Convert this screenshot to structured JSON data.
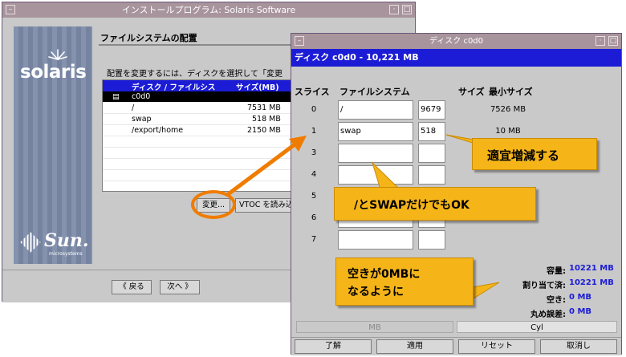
{
  "back_window": {
    "title": "インストールプログラム: Solaris Software",
    "brand": "solaris",
    "sun_brand": "Sun.",
    "sun_sub": "microsystems",
    "page_title": "ファイルシステムの配置",
    "instruction": "配置を変更するには、ディスクを選択して「変更",
    "list": {
      "headers": [
        "ディスク / ファイルシス",
        "サイズ(MB)"
      ],
      "rows": [
        {
          "name": "c0d0",
          "size": "",
          "selected": true
        },
        {
          "name": "/",
          "size": "7531 MB",
          "selected": false
        },
        {
          "name": "swap",
          "size": "518 MB",
          "selected": false
        },
        {
          "name": "/export/home",
          "size": "2150 MB",
          "selected": false
        }
      ]
    },
    "change_button": "変更...",
    "vtoc_button": "VTOC を読み込",
    "back_button": "《 戻る",
    "next_button": "次へ 》"
  },
  "front_window": {
    "title": "ディスク c0d0",
    "header": "ディスク c0d0 - 10,221 MB",
    "columns": {
      "slice": "スライス",
      "fs": "ファイルシステム",
      "size": "サイズ",
      "min": "最小サイズ"
    },
    "slices": [
      {
        "num": "0",
        "fs": "/",
        "size": "9679",
        "min": "7526 MB"
      },
      {
        "num": "1",
        "fs": "swap",
        "size": "518",
        "min": "10 MB"
      },
      {
        "num": "3",
        "fs": "",
        "size": "",
        "min": ""
      },
      {
        "num": "4",
        "fs": "",
        "size": "",
        "min": ""
      },
      {
        "num": "5",
        "fs": "",
        "size": "",
        "min": ""
      },
      {
        "num": "6",
        "fs": "",
        "size": "",
        "min": ""
      },
      {
        "num": "7",
        "fs": "",
        "size": "",
        "min": ""
      }
    ],
    "summary": [
      {
        "label": "容量:",
        "value": "10221 MB"
      },
      {
        "label": "割り当て済:",
        "value": "10221 MB"
      },
      {
        "label": "空き:",
        "value": "0 MB"
      },
      {
        "label": "丸め誤差:",
        "value": "0 MB"
      }
    ],
    "unit_mb": "MB",
    "unit_cyl": "Cyl",
    "buttons": {
      "ok": "了解",
      "apply": "適用",
      "reset": "リセット",
      "cancel": "取消し"
    }
  },
  "callouts": {
    "adjust": "適宜増減する",
    "root_swap": "/とSWAPだけでもOK",
    "free_zero_line1": "空きが0MBに",
    "free_zero_line2": "なるように"
  },
  "colors": {
    "selection_blue": "#1c1cd6",
    "callout_orange": "#f5b519",
    "highlight_ring": "#ef7c00",
    "titlebar": "#a8949c"
  }
}
